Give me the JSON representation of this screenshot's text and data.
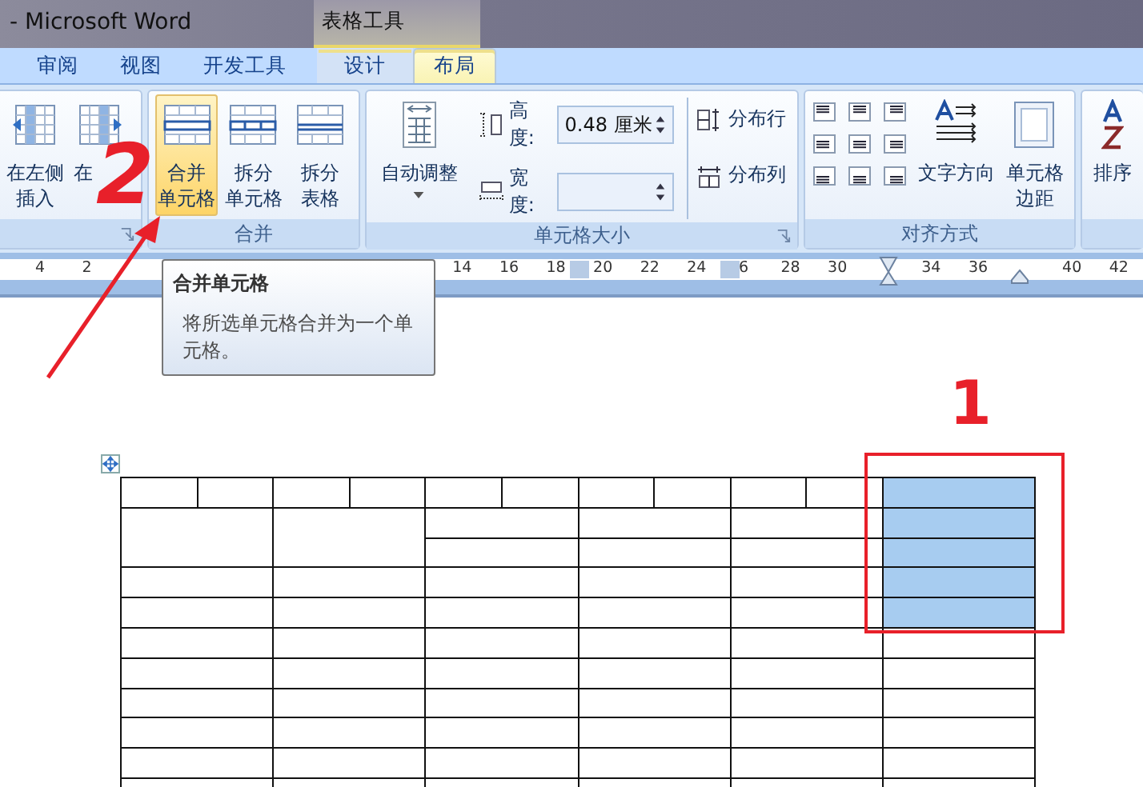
{
  "title_bar": {
    "document_title": "- Microsoft Word",
    "context_group": "表格工具"
  },
  "tabs": [
    {
      "label": "审阅",
      "selected": false,
      "contextual": false
    },
    {
      "label": "视图",
      "selected": false,
      "contextual": false
    },
    {
      "label": "开发工具",
      "selected": false,
      "contextual": false
    },
    {
      "label": "设计",
      "selected": false,
      "contextual": true
    },
    {
      "label": "布局",
      "selected": true,
      "contextual": true
    }
  ],
  "ribbon": {
    "insert_group": {
      "buttons": [
        {
          "lines": [
            "在左侧",
            "插入"
          ]
        },
        {
          "lines": [
            "在"
          ]
        }
      ]
    },
    "merge_group": {
      "label": "合并",
      "buttons": [
        {
          "lines": [
            "合并",
            "单元格"
          ],
          "selected": true
        },
        {
          "lines": [
            "拆分",
            "单元格"
          ],
          "selected": false
        },
        {
          "lines": [
            "拆分",
            "表格"
          ],
          "selected": false
        }
      ]
    },
    "size_group": {
      "label": "单元格大小",
      "autofit": "自动调整",
      "height_label": "高度:",
      "height_value": "0.48 厘米",
      "width_label": "宽度:",
      "distribute_rows": "分布行",
      "distribute_columns": "分布列"
    },
    "align_group": {
      "label": "对齐方式",
      "text_direction": "文字方向",
      "cell_margins": [
        "单元格",
        "边距"
      ]
    },
    "sort_group": {
      "label": "排序"
    }
  },
  "ruler": {
    "ticks": [
      "4",
      "2",
      "14",
      "16",
      "18",
      "20",
      "22",
      "24",
      "6",
      "28",
      "30",
      "34",
      "36",
      "40",
      "42"
    ]
  },
  "tooltip": {
    "title": "合并单元格",
    "body": "将所选单元格合并为一个单元格。"
  },
  "annotations": [
    {
      "label": "2"
    },
    {
      "label": "1"
    }
  ],
  "table": {
    "rows": [
      {
        "selected": true
      },
      {
        "selected": true
      },
      {
        "selected": true
      },
      {
        "selected": true
      },
      {
        "selected": true
      },
      {
        "selected": false
      },
      {
        "selected": false
      },
      {
        "selected": false
      },
      {
        "selected": false
      },
      {
        "selected": false
      },
      {
        "selected": false
      }
    ]
  }
}
